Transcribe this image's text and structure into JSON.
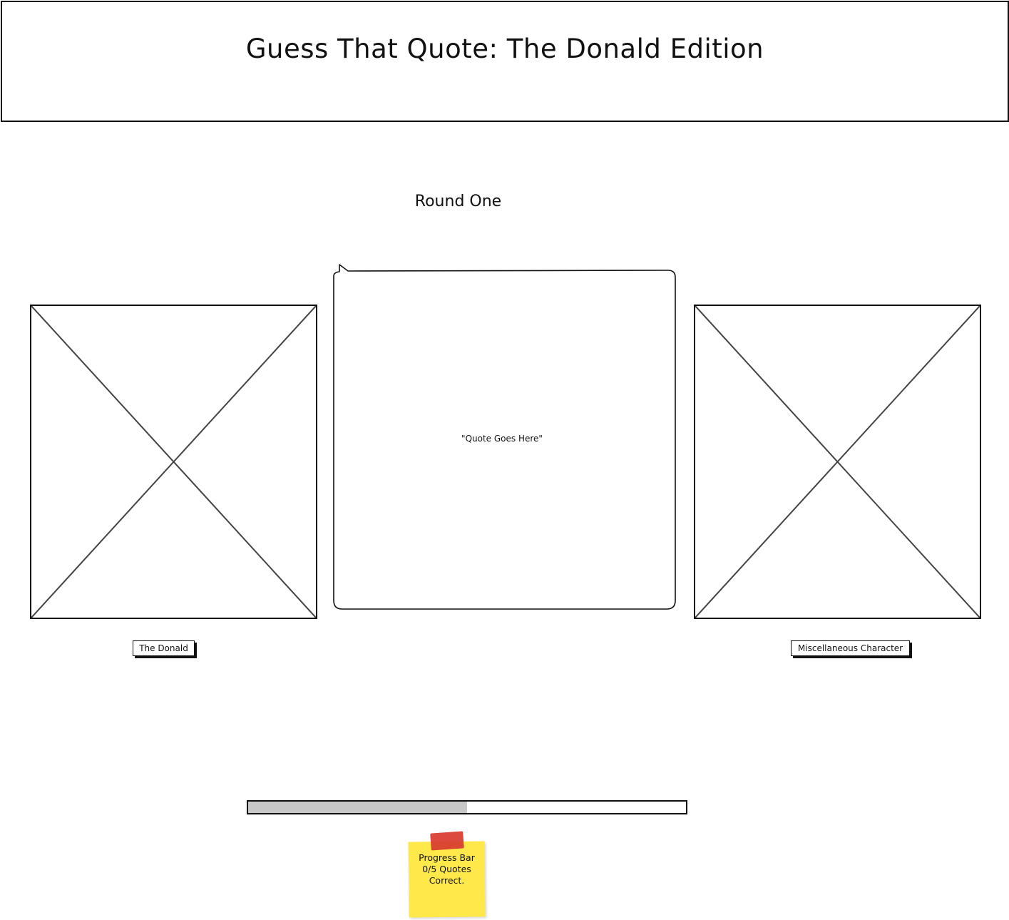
{
  "header": {
    "title": "Guess That Quote: The Donald Edition"
  },
  "round": {
    "title": "Round One"
  },
  "quote": {
    "text": "\"Quote Goes Here\""
  },
  "choices": {
    "left_label": "The Donald",
    "right_label": "Miscellaneous Character"
  },
  "progress": {
    "fraction": 0.5,
    "note": "Progress Bar\n0/5 Quotes\nCorrect."
  },
  "colors": {
    "progress_fill": "#c8c8c8",
    "sticky_note": "#ffe84a",
    "sticky_tape": "#d83a2f"
  },
  "icons": {
    "left_image": "image-placeholder-icon",
    "right_image": "image-placeholder-icon"
  }
}
